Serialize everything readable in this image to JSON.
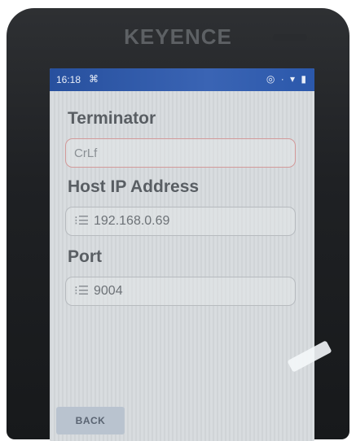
{
  "device": {
    "brand": "KEYENCE"
  },
  "status_bar": {
    "time": "16:18",
    "notification_icon": "scan-icon",
    "right_icons": "◎ · ▾ ▮"
  },
  "form": {
    "terminator_label": "Terminator",
    "terminator_value": "CrLf",
    "host_label": "Host IP Address",
    "host_value": "192.168.0.69",
    "port_label": "Port",
    "port_value": "9004",
    "list_icon_glyph": "⁝☰"
  },
  "actions": {
    "back_label": "BACK"
  }
}
